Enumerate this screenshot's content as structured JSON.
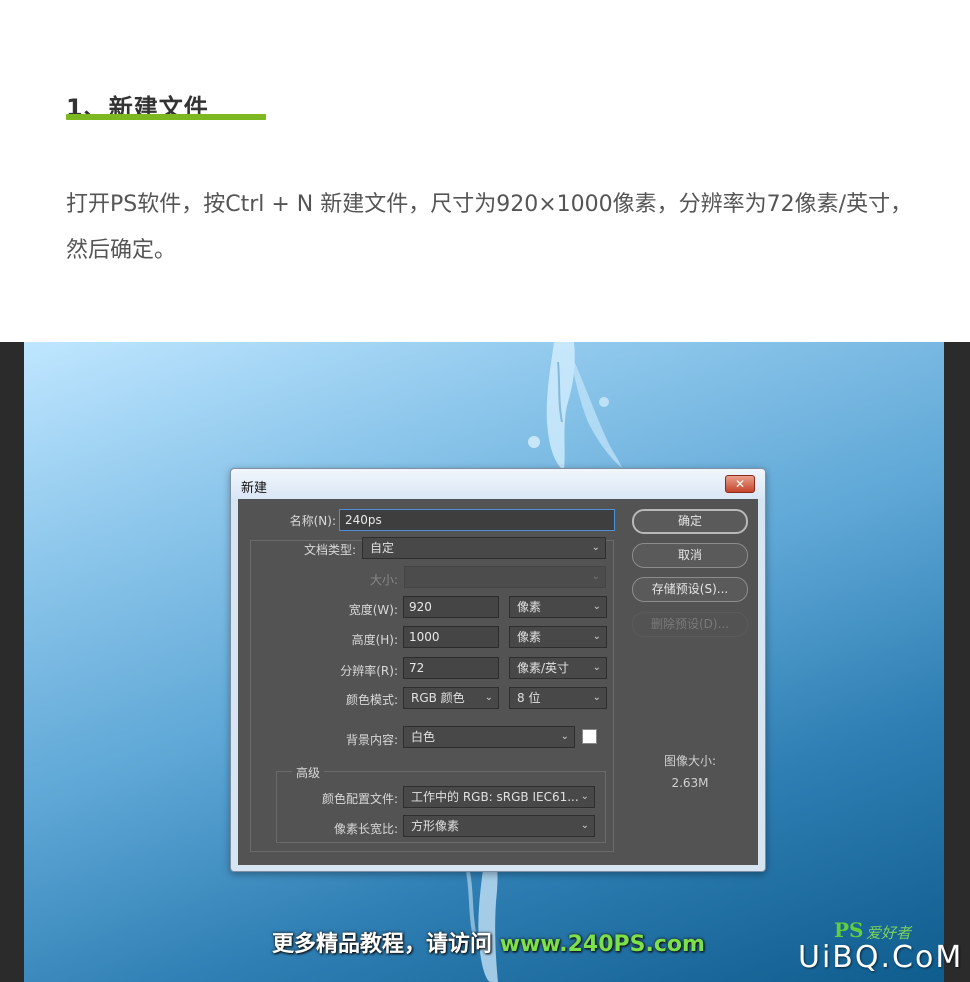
{
  "article": {
    "heading": "1、新建文件",
    "paragraph": "打开PS软件，按Ctrl + N 新建文件，尺寸为920×1000像素，分辨率为72像素/英寸，然后确定。"
  },
  "dialog": {
    "title": "新建",
    "close_label": "✕",
    "name_label": "名称(N):",
    "name_value": "240ps",
    "doc_type_label": "文档类型:",
    "doc_type_value": "自定",
    "size_label": "大小:",
    "size_value": "",
    "width_label": "宽度(W):",
    "width_value": "920",
    "width_unit": "像素",
    "height_label": "高度(H):",
    "height_value": "1000",
    "height_unit": "像素",
    "resolution_label": "分辨率(R):",
    "resolution_value": "72",
    "resolution_unit": "像素/英寸",
    "color_mode_label": "颜色模式:",
    "color_mode_value": "RGB 颜色",
    "bit_depth_value": "8 位",
    "background_label": "背景内容:",
    "background_value": "白色",
    "advanced_label": "高级",
    "color_profile_label": "颜色配置文件:",
    "color_profile_value": "工作中的 RGB: sRGB IEC61...",
    "pixel_aspect_label": "像素长宽比:",
    "pixel_aspect_value": "方形像素",
    "buttons": {
      "ok": "确定",
      "cancel": "取消",
      "save_preset": "存储预设(S)...",
      "delete_preset": "删除预设(D)..."
    },
    "image_size_label": "图像大小:",
    "image_size_value": "2.63M"
  },
  "watermark": {
    "promo_text": "更多精品教程，请访问",
    "promo_url": "www.240PS.com",
    "logo_ps": "PS",
    "logo_zh": "爱好者",
    "logo_main": "UiBQ.CoM"
  },
  "colors": {
    "accent_underline": "#7cb820",
    "dialog_body": "#535353",
    "promo_url": "#7be04a"
  }
}
